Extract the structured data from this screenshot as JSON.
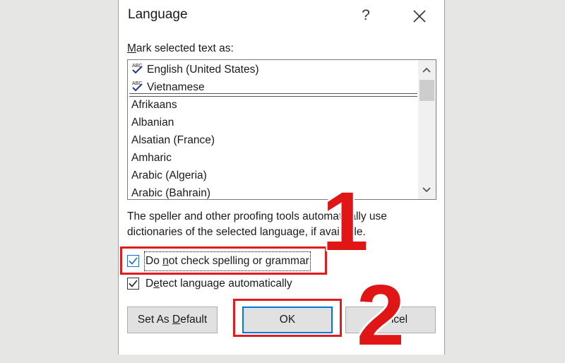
{
  "dialog": {
    "title": "Language",
    "help_glyph": "?",
    "mark_label_prefix": "M",
    "mark_label_rest": "ark selected text as:",
    "pinned_languages": [
      "English (United States)",
      "Vietnamese"
    ],
    "languages": [
      "Afrikaans",
      "Albanian",
      "Alsatian (France)",
      "Amharic",
      "Arabic (Algeria)",
      "Arabic (Bahrain)"
    ],
    "info_text": "The speller and other proofing tools automatically use dictionaries of the selected language, if available.",
    "no_check": {
      "pre": "Do ",
      "underline": "n",
      "post": "ot check spelling or grammar",
      "checked": true
    },
    "detect": {
      "pre": "D",
      "underline": "e",
      "post": "tect language automatically",
      "checked": true
    },
    "set_default": {
      "pre": "Set As ",
      "underline": "D",
      "post": "efault"
    },
    "ok_label": "OK",
    "cancel_label": "Cancel"
  },
  "annotations": {
    "step1": "1",
    "step2": "2",
    "highlight_color": "#e01c1c"
  },
  "icons": [
    "proofing-abc-icon",
    "close-icon",
    "help-icon",
    "scroll-up-icon",
    "scroll-down-icon",
    "checkmark-icon"
  ]
}
